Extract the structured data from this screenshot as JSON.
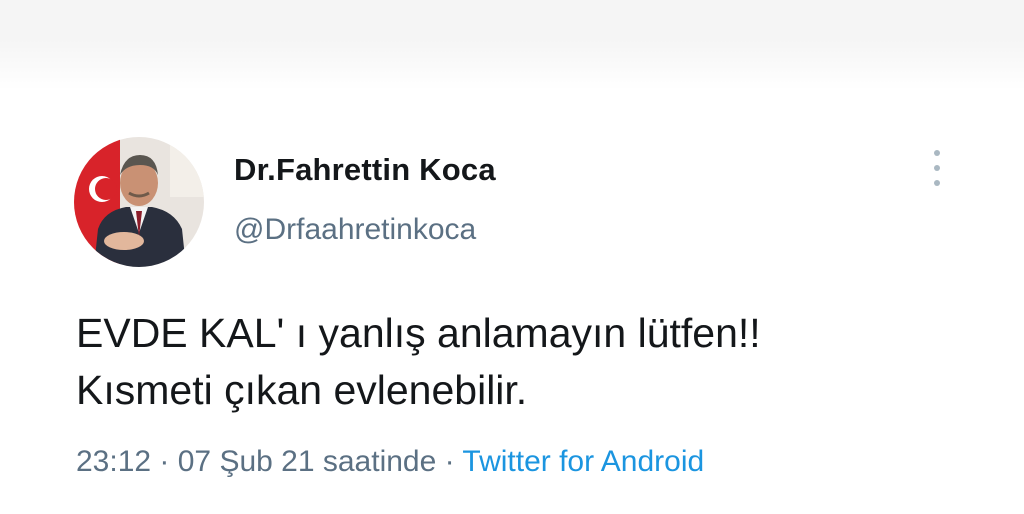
{
  "tweet": {
    "author": {
      "display_name": "Dr.Fahrettin Koca",
      "handle": "@Drfaahretinkoca",
      "avatar_icon": "profile-photo"
    },
    "more_icon": "more-vertical-icon",
    "text_lines": [
      "EVDE KAL' ı yanlış anlamayın lütfen!!",
      "Kısmeti çıkan evlenebilir."
    ],
    "meta": {
      "time": "23:12",
      "separator": " · ",
      "date": "07 Şub 21 saatinde",
      "source": "Twitter for Android"
    }
  },
  "colors": {
    "text": "#14171a",
    "secondary": "#5b7083",
    "link": "#1b95e0"
  }
}
